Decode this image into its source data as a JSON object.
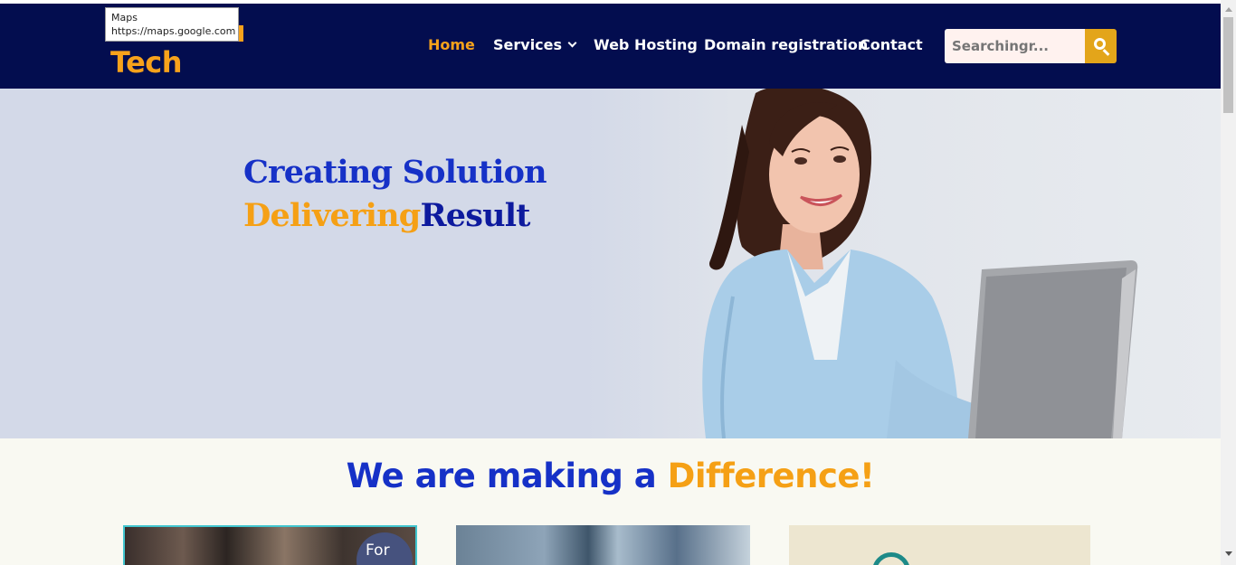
{
  "tooltip": {
    "title": "Maps",
    "url": "https://maps.google.com"
  },
  "logo": {
    "text": "Tech"
  },
  "nav": {
    "items": [
      {
        "label": "Home",
        "active": true
      },
      {
        "label": "Services",
        "has_dropdown": true
      },
      {
        "label": "Web Hosting"
      },
      {
        "label": "Domain registration"
      },
      {
        "label": "Contact"
      }
    ]
  },
  "search": {
    "placeholder": "Searchingr...",
    "icon": "search-icon"
  },
  "hero": {
    "line1": "Creating Solution",
    "line2_part1": "Delivering",
    "line2_part2": "Result"
  },
  "section": {
    "heading_part1": "We are making a ",
    "heading_part2": "Difference!"
  },
  "cards": [
    {
      "badge": "For"
    },
    {},
    {}
  ],
  "colors": {
    "header_bg": "#030d4f",
    "accent_orange": "#f7a21b",
    "hero_blue": "#1631c7",
    "search_button": "#e3a51a"
  }
}
